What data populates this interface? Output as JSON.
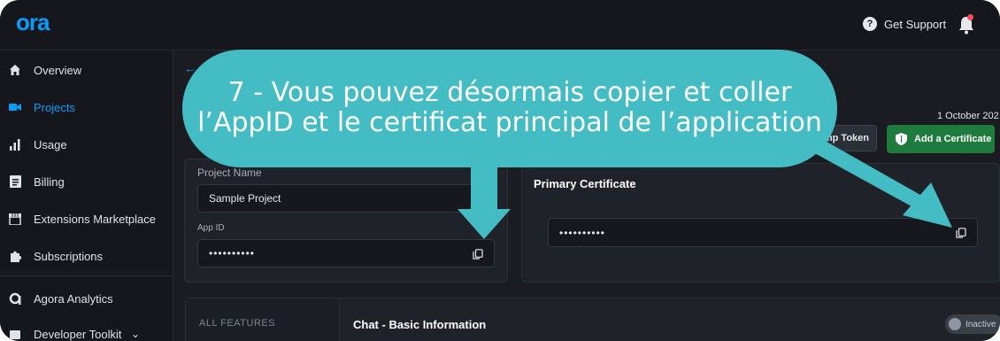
{
  "header": {
    "logo": "ora",
    "support_label": "Get Support",
    "support_icon": "?"
  },
  "sidebar": {
    "items": [
      {
        "label": "Overview",
        "icon": "home-icon"
      },
      {
        "label": "Projects",
        "icon": "video-icon",
        "active": true
      },
      {
        "label": "Usage",
        "icon": "bar-chart-icon"
      },
      {
        "label": "Billing",
        "icon": "document-icon"
      },
      {
        "label": "Extensions Marketplace",
        "icon": "store-icon"
      },
      {
        "label": "Subscriptions",
        "icon": "puzzle-icon"
      },
      {
        "label": "Agora Analytics",
        "icon": "agora-a-icon"
      },
      {
        "label": "Developer Toolkit",
        "icon": "toolkit-icon"
      }
    ]
  },
  "main": {
    "date": "1 October 202",
    "temp_token_button": "mp Token",
    "add_certificate_button": "Add a Certificate",
    "project_name_label": "Project Name",
    "project_name_value": "Sample Project",
    "app_id_label": "App ID",
    "app_id_value": "••••••••••",
    "primary_certificate_title": "Primary Certificate",
    "primary_certificate_value": "••••••••••",
    "features_label": "ALL FEATURES",
    "feature_title": "Chat - Basic Information",
    "feature_status": "Inactive"
  },
  "callout": {
    "line1": "7 - Vous pouvez désormais copier et coller",
    "line2": "l’AppID et le certificat principal de l’application",
    "color": "#43bcc4"
  },
  "colors": {
    "accent": "#099dfd",
    "success": "#1f7a3e",
    "background": "#1a1c22"
  }
}
